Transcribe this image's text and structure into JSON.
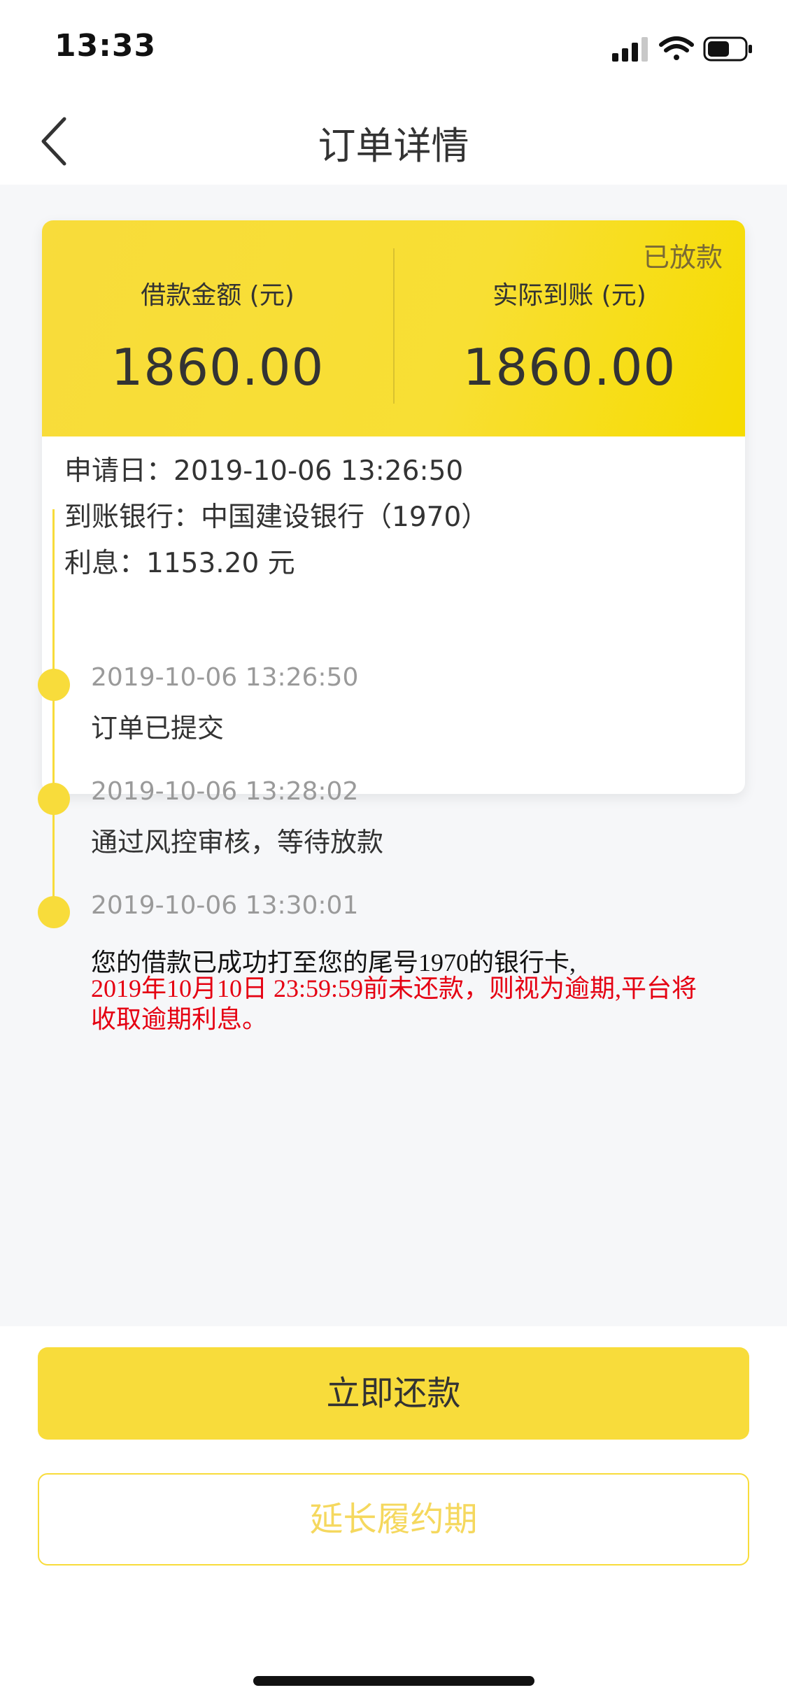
{
  "status_bar": {
    "time": "13:33",
    "icons": [
      "signal-icon",
      "wifi-icon",
      "battery-icon"
    ],
    "battery_level": 0.6
  },
  "nav": {
    "title": "订单详情",
    "back_icon": "chevron-left-icon"
  },
  "card": {
    "status_badge": "已放款",
    "loan_amount_label": "借款金额 (元)",
    "loan_amount_value": "1860.00",
    "received_label": "实际到账 (元)",
    "received_value": "1860.00",
    "info": [
      "申请日：2019-10-06 13:26:50",
      "到账银行：中国建设银行（1970）",
      "利息：1153.20 元"
    ]
  },
  "timeline": [
    {
      "time": "2019-10-06 13:26:50",
      "text": "订单已提交"
    },
    {
      "time": "2019-10-06 13:28:02",
      "text": "通过风控审核，等待放款"
    },
    {
      "time": "2019-10-06 13:30:01",
      "text": "您的借款已成功打至您的尾号1970的银行卡,",
      "warning": "2019年10月10日 23:59:59前未还款，则视为逾期,平台将收取逾期利息。"
    }
  ],
  "buttons": {
    "repay": "立即还款",
    "extend": "延长履约期"
  },
  "colors": {
    "accent": "#f8dc3b",
    "warning": "#e50012",
    "background": "#f6f7f9",
    "muted_text": "#9a9a9a"
  }
}
